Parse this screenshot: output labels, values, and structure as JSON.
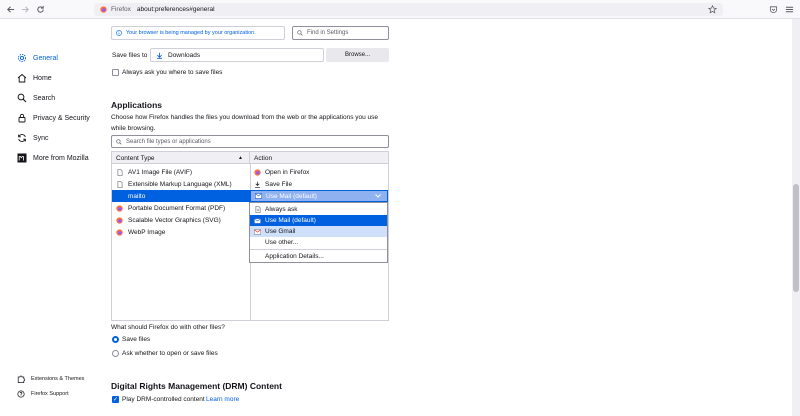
{
  "browser": {
    "identity": "Firefox",
    "url": "about:preferences#general"
  },
  "sidebar": {
    "items": [
      {
        "label": "General",
        "icon": "gear-icon"
      },
      {
        "label": "Home",
        "icon": "home-icon"
      },
      {
        "label": "Search",
        "icon": "search-icon"
      },
      {
        "label": "Privacy & Security",
        "icon": "lock-icon"
      },
      {
        "label": "Sync",
        "icon": "sync-icon"
      },
      {
        "label": "More from Mozilla",
        "icon": "mozilla-icon"
      }
    ],
    "footer": [
      {
        "label": "Extensions & Themes",
        "icon": "puzzle-icon"
      },
      {
        "label": "Firefox Support",
        "icon": "help-icon"
      }
    ],
    "accent": "#0061e0"
  },
  "policy_notice": "Your browser is being managed by your organization.",
  "find_placeholder": "Find in Settings",
  "downloads": {
    "save_files_label": "Save files to",
    "folder": "Downloads",
    "browse_label": "Browse...",
    "always_ask_label": "Always ask you where to save files"
  },
  "applications": {
    "heading": "Applications",
    "description": "Choose how Firefox handles the files you download from the web or the applications you use while browsing.",
    "search_placeholder": "Search file types or applications",
    "columns": {
      "content_type": "Content Type",
      "action": "Action"
    },
    "rows": [
      {
        "type": "AV1 Image File (AVIF)",
        "action": "Open in Firefox"
      },
      {
        "type": "Extensible Markup Language (XML)",
        "action": "Save File"
      },
      {
        "type": "mailto",
        "action": "Use Mail (default)"
      },
      {
        "type": "Portable Document Format (PDF)",
        "action": ""
      },
      {
        "type": "Scalable Vector Graphics (SVG)",
        "action": ""
      },
      {
        "type": "WebP Image",
        "action": ""
      }
    ],
    "menu": [
      "Always ask",
      "Use Mail (default)",
      "Use Gmail",
      "Use other...",
      "Application Details..."
    ]
  },
  "other_files": {
    "question": "What should Firefox do with other files?",
    "save_label": "Save files",
    "ask_label": "Ask whether to open or save files"
  },
  "drm": {
    "heading": "Digital Rights Management (DRM) Content",
    "play_label": "Play DRM-controlled content",
    "learn_more": "Learn more"
  }
}
